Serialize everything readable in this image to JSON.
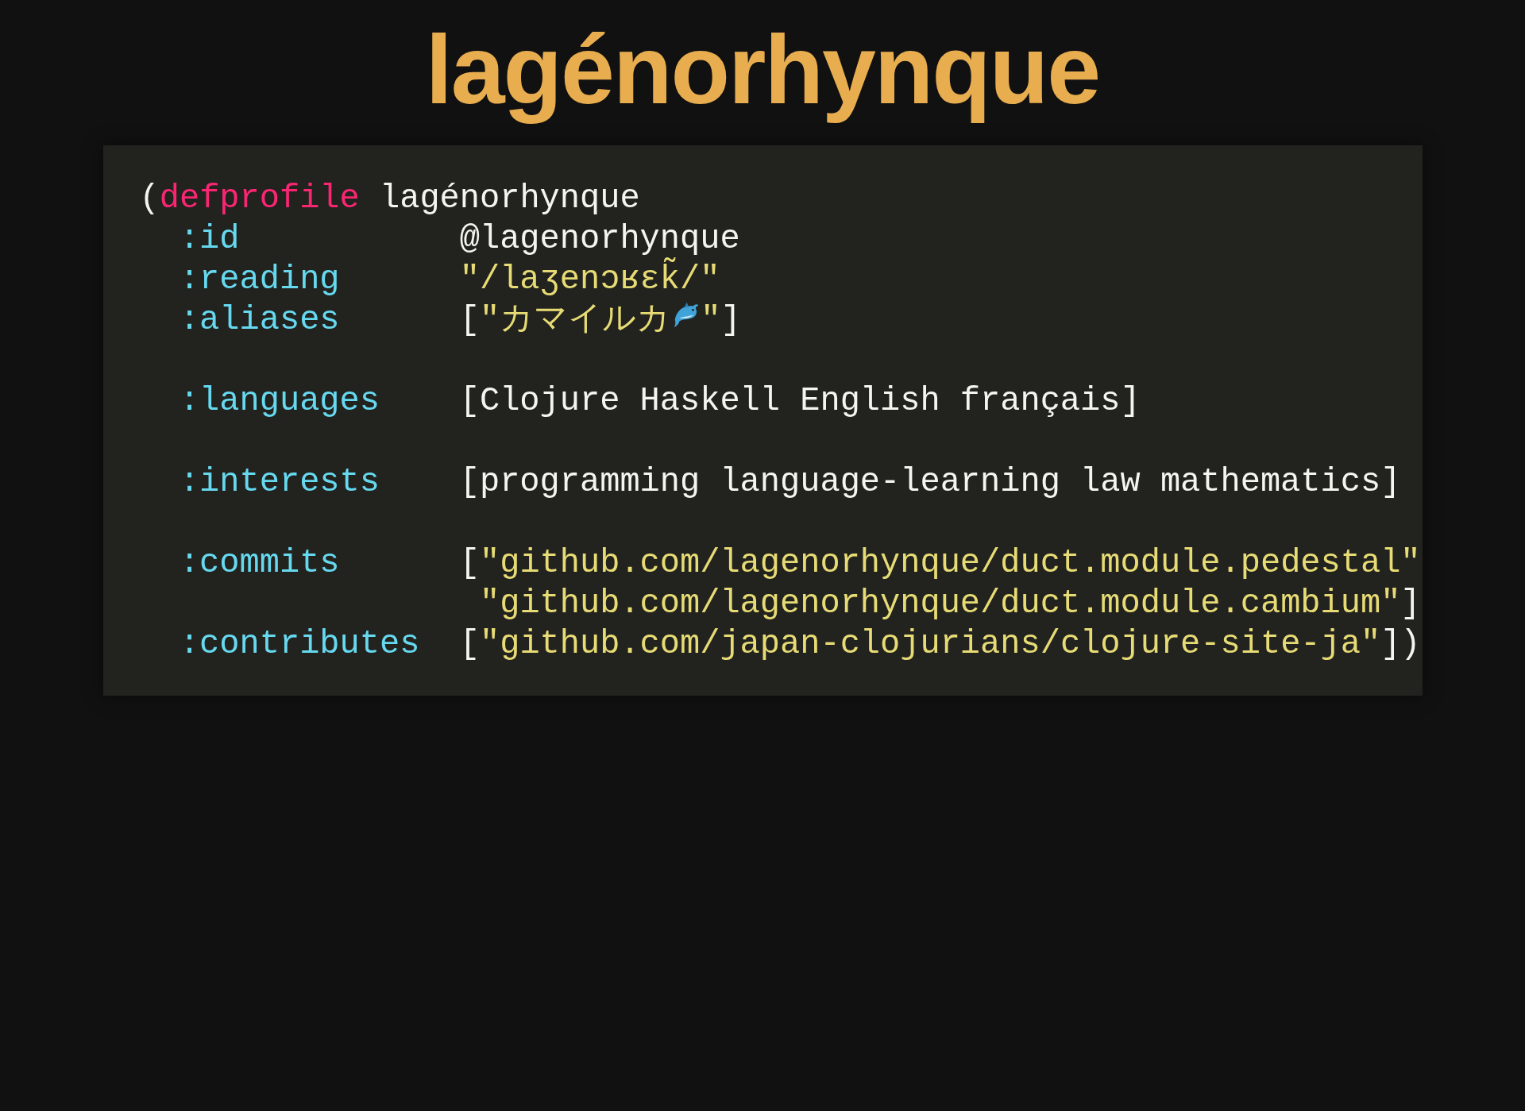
{
  "title": "lagénorhynque",
  "code": {
    "lines": [
      {
        "kind": "head",
        "tokens": [
          {
            "kind": "punct",
            "text": "("
          },
          {
            "kind": "keyword",
            "text": "defprofile"
          },
          {
            "kind": "plain",
            "text": "lagénorhynque"
          }
        ]
      },
      {
        "kind": "entry",
        "key": ":id",
        "tokens": [
          {
            "kind": "plain",
            "text": "@lagenorhynque"
          }
        ]
      },
      {
        "kind": "entry",
        "key": ":reading",
        "tokens": [
          {
            "kind": "string",
            "text": "\"/laʒenɔʁɛk̃/\""
          }
        ]
      },
      {
        "kind": "entry",
        "key": ":aliases",
        "tokens": [
          {
            "kind": "punct",
            "text": "["
          },
          {
            "kind": "string",
            "text": "\"カマイルカ"
          },
          {
            "kind": "icon"
          },
          {
            "kind": "string",
            "text": "\""
          },
          {
            "kind": "punct",
            "text": "]"
          }
        ]
      },
      {
        "kind": "blank"
      },
      {
        "kind": "entry",
        "key": ":languages",
        "tokens": [
          {
            "kind": "plain",
            "text": "[Clojure Haskell English français]"
          }
        ]
      },
      {
        "kind": "blank"
      },
      {
        "kind": "entry",
        "key": ":interests",
        "tokens": [
          {
            "kind": "plain",
            "text": "[programming language-learning law mathematics]"
          }
        ]
      },
      {
        "kind": "blank"
      },
      {
        "kind": "entry",
        "key": ":commits",
        "tokens": [
          {
            "kind": "punct",
            "text": "["
          },
          {
            "kind": "string",
            "text": "\"github.com/lagenorhynque/duct.module.pedestal\""
          }
        ]
      },
      {
        "kind": "continuation",
        "tokens": [
          {
            "kind": "string",
            "text": "\"github.com/lagenorhynque/duct.module.cambium\""
          },
          {
            "kind": "punct",
            "text": "]"
          }
        ]
      },
      {
        "kind": "entry",
        "key": ":contributes",
        "tokens": [
          {
            "kind": "punct",
            "text": "["
          },
          {
            "kind": "string",
            "text": "\"github.com/japan-clojurians/clojure-site-ja\""
          },
          {
            "kind": "punct",
            "text": "])"
          }
        ]
      }
    ]
  }
}
